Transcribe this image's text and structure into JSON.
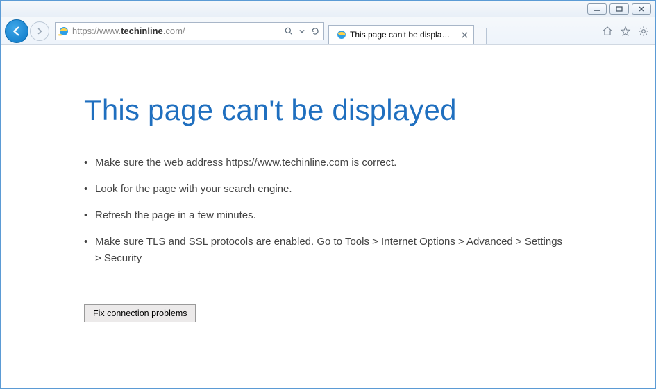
{
  "window": {
    "minimize": "minimize",
    "maximize": "maximize",
    "close": "close"
  },
  "nav": {
    "url_scheme": "https://www.",
    "url_host": "techinline",
    "url_tail": ".com/"
  },
  "tab": {
    "title": "This page can't be displayed"
  },
  "page": {
    "heading": "This page can't be displayed",
    "bullet1": "Make sure the web address https://www.techinline.com is correct.",
    "bullet2": "Look for the page with your search engine.",
    "bullet3": "Refresh the page in a few minutes.",
    "bullet4": "Make sure TLS and SSL protocols are enabled. Go to Tools > Internet Options > Advanced > Settings > Security",
    "fix_button": "Fix connection problems"
  }
}
